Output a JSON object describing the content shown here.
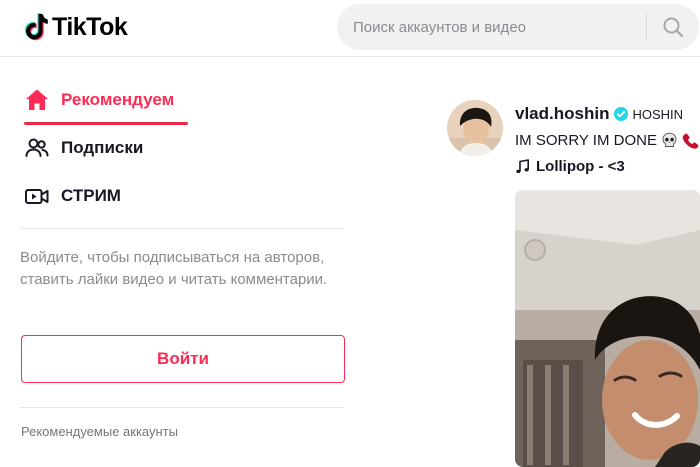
{
  "header": {
    "logo_text": "TikTok",
    "search_placeholder": "Поиск аккаунтов и видео",
    "search_icon": "search-icon"
  },
  "sidebar": {
    "nav": [
      {
        "label": "Рекомендуем",
        "icon": "home-icon",
        "active": true
      },
      {
        "label": "Подписки",
        "icon": "following-icon",
        "active": false
      },
      {
        "label": "СТРИМ",
        "icon": "live-icon",
        "active": false
      }
    ],
    "login_tip": "Войдите, чтобы подписываться на авторов, ставить лайки видео и читать комментарии.",
    "login_button": "Войти",
    "suggested_title": "Рекомендуемые аккаунты"
  },
  "feed": {
    "post": {
      "author_id": "vlad.hoshin",
      "verified": true,
      "nickname": "HOSHIN",
      "caption": "IM SORRY IM DONE",
      "caption_emojis": [
        "skull-emoji",
        "phone-emoji"
      ],
      "music": "Lollipop - <3"
    }
  },
  "colors": {
    "accent": "#fe2c55",
    "text": "#161823",
    "muted": "#8a8b91",
    "verified": "#20d5ec"
  }
}
